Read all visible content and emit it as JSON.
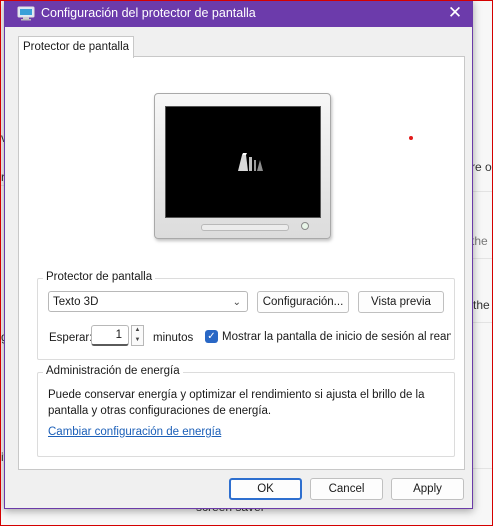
{
  "background": {
    "fragments": [
      "v",
      "rr",
      "re o",
      "the",
      "the",
      "ge",
      "it",
      "screen saver"
    ]
  },
  "dialog": {
    "title": "Configuración del protector de pantalla",
    "close_glyph": "✕",
    "tab_label": "Protector de pantalla",
    "screensaver_group": {
      "legend": "Protector de pantalla",
      "selected": "Texto 3D",
      "settings_button": "Configuración...",
      "preview_button": "Vista previa",
      "wait_label": "Esperar:",
      "wait_value": "1",
      "minutes_label": "minutos",
      "checkbox_label": "Mostrar la pantalla de inicio de sesión al reanudar",
      "checkbox_checked": true
    },
    "power_group": {
      "legend": "Administración de energía",
      "description": "Puede conservar energía y optimizar el rendimiento si ajusta el brillo de la pantalla y otras configuraciones de energía.",
      "link": "Cambiar configuración de energía"
    },
    "buttons": {
      "ok": "OK",
      "cancel": "Cancel",
      "apply": "Apply"
    }
  },
  "colors": {
    "titlebar": "#6c3bab",
    "accent": "#2967c5",
    "link": "#1b5fb8",
    "frame_red": "#d40000"
  }
}
